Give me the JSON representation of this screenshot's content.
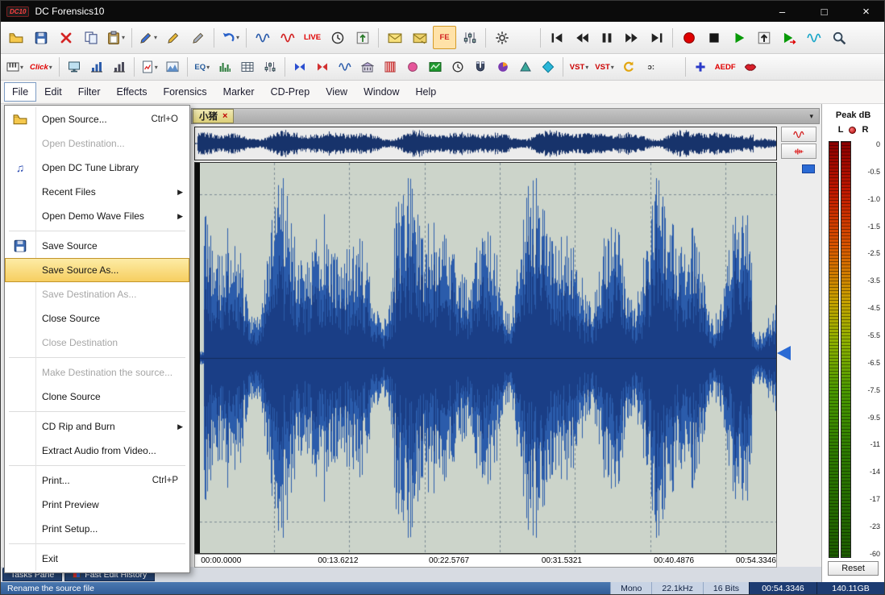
{
  "window": {
    "logo": "DC10",
    "title": "DC Forensics10",
    "minimize": "–",
    "maximize": "□",
    "close": "×"
  },
  "glyphs": {
    "dropdown": "▾",
    "submenu": "▶"
  },
  "menubar": {
    "active_index": 0,
    "items": [
      "File",
      "Edit",
      "Filter",
      "Effects",
      "Forensics",
      "Marker",
      "CD-Prep",
      "View",
      "Window",
      "Help"
    ]
  },
  "toolbar1": {
    "items": [
      {
        "n": "open-source",
        "k": "folder"
      },
      {
        "n": "save",
        "k": "floppy"
      },
      {
        "n": "close-file",
        "k": "xmark"
      },
      {
        "n": "copy",
        "k": "copy"
      },
      {
        "n": "paste",
        "k": "paste",
        "dd": true
      },
      {
        "n": "pen-tool",
        "k": "pencil",
        "c": "#3a6fd8",
        "sep": true,
        "dd": true
      },
      {
        "n": "pencil",
        "k": "pencil",
        "c": "#e8b93a"
      },
      {
        "n": "scalpel",
        "k": "pencil",
        "c": "#a5afc0"
      },
      {
        "n": "undo",
        "k": "undo",
        "sep": true,
        "dd": true
      },
      {
        "n": "wave-edit",
        "k": "wave",
        "c": "#2b5cab",
        "sep": true
      },
      {
        "n": "wave-marker",
        "k": "wave",
        "c": "#d22020"
      },
      {
        "n": "live-record",
        "t": "LIVE",
        "c": "#e00000"
      },
      {
        "n": "timer",
        "k": "clock"
      },
      {
        "n": "gain-elevator",
        "k": "up2"
      },
      {
        "n": "envelope",
        "k": "envelope",
        "sep": true
      },
      {
        "n": "envelope-send",
        "k": "envelope2"
      },
      {
        "n": "fast-edit",
        "t": "FE",
        "c": "#d22020",
        "hl": true
      },
      {
        "n": "level-faders",
        "k": "sliders"
      },
      {
        "n": "settings-gear",
        "k": "gear",
        "sep": true
      },
      {
        "sp": 26
      },
      {
        "n": "skip-start",
        "k": "skipL",
        "sep": true
      },
      {
        "n": "rewind",
        "k": "rew"
      },
      {
        "n": "pause",
        "k": "pause"
      },
      {
        "n": "fast-forward",
        "k": "ff"
      },
      {
        "n": "skip-end",
        "k": "skipR"
      },
      {
        "n": "record",
        "k": "record",
        "sep": true
      },
      {
        "n": "stop",
        "k": "stop"
      },
      {
        "n": "play",
        "k": "play"
      },
      {
        "n": "eject-up",
        "k": "upbox"
      },
      {
        "n": "play-processed",
        "k": "play2"
      },
      {
        "n": "wave-preview",
        "k": "wave",
        "c": "#18a6c8"
      },
      {
        "n": "zoom",
        "k": "magnifier"
      }
    ]
  },
  "toolbar2": {
    "items": [
      {
        "n": "keyboard",
        "k": "piano",
        "dd": true
      },
      {
        "n": "click-repair",
        "t": "Click",
        "c": "#e00000",
        "i": true,
        "dd": true
      },
      {
        "n": "monitor",
        "k": "monitor",
        "sep": true
      },
      {
        "n": "histogram",
        "k": "bars",
        "c": "#2b5cab"
      },
      {
        "n": "spectrogram",
        "k": "bars",
        "c": "#4a4a5a"
      },
      {
        "n": "file-analysis",
        "k": "filechart",
        "dd": true,
        "sep": true
      },
      {
        "n": "area-view",
        "k": "mountain"
      },
      {
        "n": "equalizer",
        "t": "EQ",
        "c": "#245a9a",
        "dd": true,
        "sep": true
      },
      {
        "n": "spectrum-analyzer",
        "k": "spectrum"
      },
      {
        "n": "data-table",
        "k": "table"
      },
      {
        "n": "mixer-faders",
        "k": "sliders"
      },
      {
        "n": "bowtie-filter",
        "k": "bowtie",
        "c": "#2b4fd0",
        "sep": true
      },
      {
        "n": "notch-filter",
        "k": "bowtie",
        "c": "#d23030"
      },
      {
        "n": "wave-tool",
        "k": "wave",
        "c": "#2b5cab"
      },
      {
        "n": "room-sim",
        "k": "building"
      },
      {
        "n": "comb-filter",
        "k": "curtain"
      },
      {
        "n": "marker-dot",
        "k": "circle",
        "c": "#e5569a"
      },
      {
        "n": "green-display",
        "k": "greenchart"
      },
      {
        "n": "time-clock",
        "k": "clock"
      },
      {
        "n": "magnet-tool",
        "k": "magnet"
      },
      {
        "n": "pie-analysis",
        "k": "pie"
      },
      {
        "n": "prism-tool",
        "k": "triangle",
        "c": "#3aa89a"
      },
      {
        "n": "gem-tool",
        "k": "diamond",
        "c": "#2ab6d8"
      },
      {
        "n": "vst-plugins",
        "t": "VST",
        "c": "#cc0000",
        "dd": true,
        "sep": true
      },
      {
        "n": "vst-rack",
        "t": "VST",
        "c": "#cc0000",
        "dd": true
      },
      {
        "n": "resample",
        "k": "refresh"
      },
      {
        "n": "punctuate",
        "t": "ɔ:",
        "c": "#333333"
      },
      {
        "sp": 22
      },
      {
        "n": "add-plus",
        "k": "plus",
        "sep": true
      },
      {
        "n": "aedf-tool",
        "t": "AEDF",
        "c": "#e00000"
      },
      {
        "n": "lips-deesser",
        "k": "lips"
      }
    ]
  },
  "file_menu": {
    "items": [
      {
        "label": "Open Source...",
        "shortcut": "Ctrl+O",
        "icon": "folder"
      },
      {
        "label": "Open Destination...",
        "disabled": true
      },
      {
        "label": "Open DC Tune Library",
        "icon": "notes"
      },
      {
        "label": "Recent Files",
        "submenu": true
      },
      {
        "label": "Open Demo Wave Files",
        "submenu": true,
        "sep": true
      },
      {
        "label": "Save Source",
        "icon": "floppy"
      },
      {
        "label": "Save Source As...",
        "highlight": true
      },
      {
        "label": "Save Destination As...",
        "disabled": true
      },
      {
        "label": "Close Source"
      },
      {
        "label": "Close Destination",
        "disabled": true,
        "sep": true
      },
      {
        "label": "Make Destination the source...",
        "disabled": true
      },
      {
        "label": "Clone Source",
        "sep": true
      },
      {
        "label": "CD Rip and Burn",
        "submenu": true
      },
      {
        "label": "Extract Audio from Video...",
        "sep": true
      },
      {
        "label": "Print...",
        "shortcut": "Ctrl+P"
      },
      {
        "label": "Print Preview"
      },
      {
        "label": "Print Setup...",
        "sep": true
      },
      {
        "label": "Exit"
      }
    ]
  },
  "tabstrip": {
    "active_tab": "小猪",
    "close_glyph": "×",
    "list_dropdown_glyph": "▾"
  },
  "timeline": {
    "labels": [
      "00:00.0000",
      "00:13.6212",
      "00:22.5767",
      "00:31.5321",
      "00:40.4876",
      "00:54.3346"
    ]
  },
  "meter": {
    "title": "Peak dB",
    "left_label": "L",
    "right_label": "R",
    "scale": [
      "0",
      "-0.5",
      "-1.0",
      "-1.5",
      "-2.5",
      "-3.5",
      "-4.5",
      "-5.5",
      "-6.5",
      "-7.5",
      "-9.5",
      "-11",
      "-14",
      "-17",
      "-23",
      "-60"
    ],
    "reset_label": "Reset"
  },
  "bottom_tabs": {
    "items": [
      "Tasks Pane",
      "Fast Edit History"
    ]
  },
  "statusbar": {
    "message": "Rename the source file",
    "channels": "Mono",
    "sample_rate": "22.1kHz",
    "bit_depth": "16 Bits",
    "time": "00:54.3346",
    "disk_space": "140.11GB"
  }
}
